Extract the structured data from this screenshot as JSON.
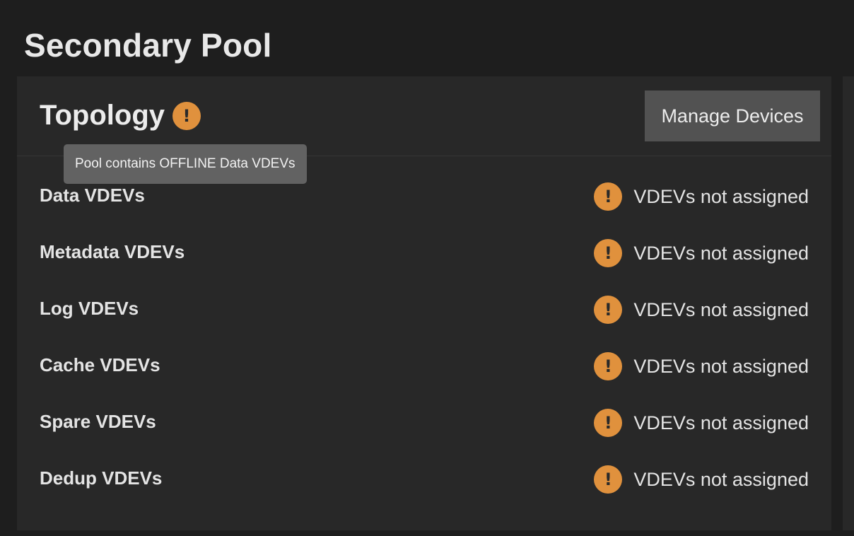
{
  "page": {
    "title": "Secondary Pool"
  },
  "topology": {
    "title": "Topology",
    "warning_icon": "exclamation-circle-icon",
    "manage_devices_label": "Manage Devices",
    "tooltip": "Pool contains OFFLINE Data VDEVs",
    "rows": [
      {
        "label": "Data VDEVs",
        "status": "VDEVs not assigned",
        "icon": "warning-icon"
      },
      {
        "label": "Metadata VDEVs",
        "status": "VDEVs not assigned",
        "icon": "warning-icon"
      },
      {
        "label": "Log VDEVs",
        "status": "VDEVs not assigned",
        "icon": "warning-icon"
      },
      {
        "label": "Cache VDEVs",
        "status": "VDEVs not assigned",
        "icon": "warning-icon"
      },
      {
        "label": "Spare VDEVs",
        "status": "VDEVs not assigned",
        "icon": "warning-icon"
      },
      {
        "label": "Dedup VDEVs",
        "status": "VDEVs not assigned",
        "icon": "warning-icon"
      }
    ]
  },
  "colors": {
    "background": "#1e1e1e",
    "card": "#282828",
    "warning": "#e0913d",
    "button": "#525252",
    "tooltip": "#626262"
  }
}
